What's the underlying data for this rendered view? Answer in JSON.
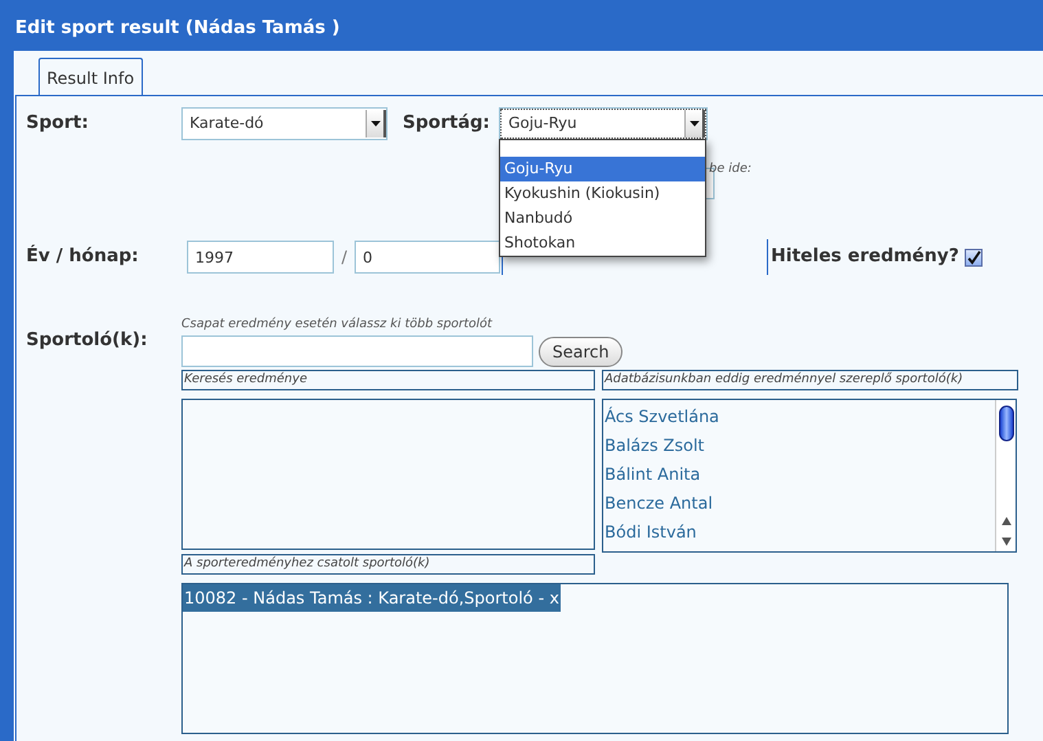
{
  "window": {
    "title": "Edit sport result (Nádas Tamás )"
  },
  "tabs": [
    {
      "label": "Result Info",
      "selected": true
    }
  ],
  "sport": {
    "label": "Sport:",
    "value": "Karate-dó"
  },
  "sportag": {
    "label": "Sportág:",
    "value": "Goju-Ryu",
    "expanded": true,
    "options": [
      {
        "kind": "blank",
        "selected": false
      },
      {
        "label": "Goju-Ryu",
        "selected": true
      },
      {
        "label": "Kyokushin (Kiokusin)",
        "selected": false
      },
      {
        "label": "Nanbudó",
        "selected": false
      },
      {
        "label": "Shotokan",
        "selected": false
      }
    ]
  },
  "hint_partial": "be ide:",
  "date": {
    "label": "Év / hónap:",
    "year": "1997",
    "separator": "/",
    "month": "0"
  },
  "verified": {
    "label": "Hiteles eredmény?",
    "checked": true
  },
  "athletes": {
    "label": "Sportoló(k):",
    "hint": "Csapat eredmény esetén válassz ki több sportolót",
    "search_button": "Search",
    "search_results_caption": "Keresés eredménye",
    "database_caption": "Adatbázisunkban eddig eredménnyel szereplő sportoló(k)",
    "database_list": [
      "Ács Szvetlána",
      "Balázs Zsolt",
      "Bálint Anita",
      "Bencze Antal",
      "Bódi István"
    ],
    "attached_caption": "A sporteredményhez csatolt sportoló(k)",
    "attached": [
      {
        "label": "10082 - Nádas Tamás : Karate-dó,Sportoló - x",
        "selected": true
      }
    ]
  }
}
